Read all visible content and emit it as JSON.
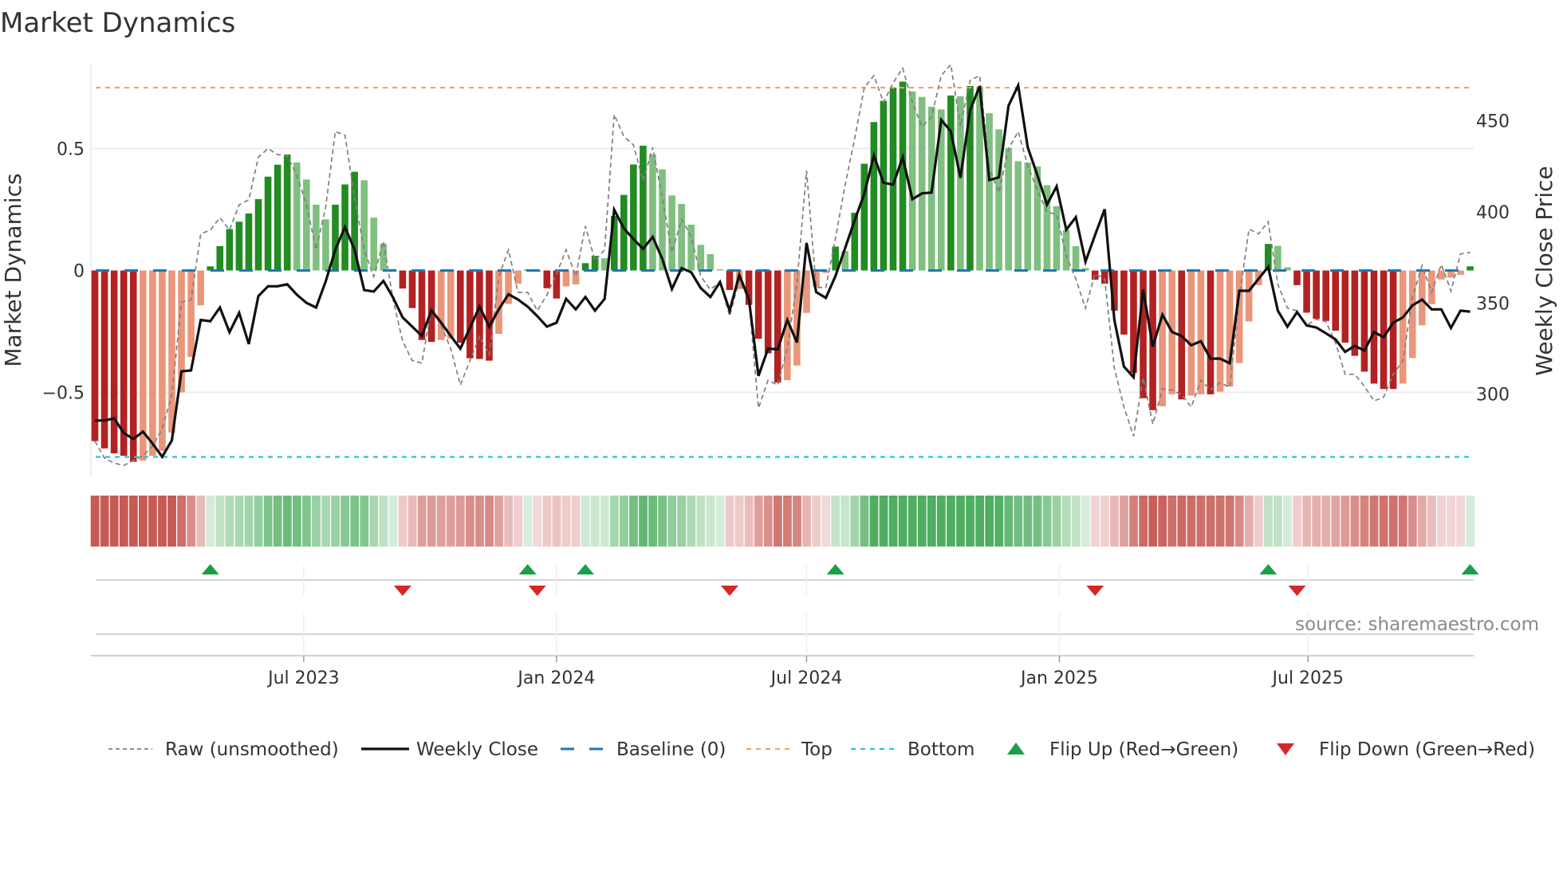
{
  "chart_data": {
    "type": "bar",
    "title": "Market Dynamics",
    "ylabel_left": "Market Dynamics",
    "ylabel_right": "Weekly Close Price",
    "source": "source: sharemaestro.com",
    "x_start": "2023-01-30",
    "x_step_days": 7,
    "ylim_left": [
      -0.845,
      0.845
    ],
    "ylim_right": [
      254.8,
      480.9
    ],
    "yticks_left": [
      {
        "v": 0.5,
        "label": "0.5"
      },
      {
        "v": 0,
        "label": "0"
      },
      {
        "v": -0.5,
        "label": "−0.5"
      }
    ],
    "yticks_right": [
      {
        "v": 450,
        "label": "450"
      },
      {
        "v": 400,
        "label": "400"
      },
      {
        "v": 350,
        "label": "350"
      },
      {
        "v": 300,
        "label": "300"
      }
    ],
    "xticks": [
      {
        "date": "2023-07-01",
        "label": "Jul 2023"
      },
      {
        "date": "2024-01-01",
        "label": "Jan 2024"
      },
      {
        "date": "2024-07-01",
        "label": "Jul 2024"
      },
      {
        "date": "2025-01-01",
        "label": "Jan 2025"
      },
      {
        "date": "2025-07-01",
        "label": "Jul 2025"
      }
    ],
    "top_level": 0.75,
    "bottom_level": -0.765,
    "baseline": 0,
    "grid": true,
    "colors": {
      "dark_red": "#b22222",
      "light_red": "#e9967a",
      "dark_green": "#228b22",
      "light_green": "#7fbf7f",
      "price": "#111111",
      "raw": "#808080",
      "baseline": "#1f77b4",
      "top": "#f4a261",
      "bottom": "#22c5d6",
      "flip_up": "#1a9e48",
      "flip_down": "#d62728",
      "strip_red": "192,72,66",
      "strip_green": "60,165,80"
    },
    "momentum": [
      -0.7,
      -0.73,
      -0.75,
      -0.76,
      -0.785,
      -0.78,
      -0.76,
      -0.74,
      -0.665,
      -0.5,
      -0.355,
      -0.143,
      0.017,
      0.1,
      0.17,
      0.2,
      0.234,
      0.293,
      0.385,
      0.434,
      0.476,
      0.443,
      0.373,
      0.27,
      0.21,
      0.27,
      0.353,
      0.405,
      0.37,
      0.217,
      0.11,
      0.006,
      -0.074,
      -0.154,
      -0.285,
      -0.293,
      -0.285,
      -0.28,
      -0.296,
      -0.36,
      -0.363,
      -0.37,
      -0.26,
      -0.137,
      -0.054,
      0.004,
      -0.005,
      -0.073,
      -0.115,
      -0.065,
      -0.057,
      0.03,
      0.06,
      0.05,
      0.224,
      0.31,
      0.435,
      0.512,
      0.476,
      0.415,
      0.308,
      0.273,
      0.188,
      0.105,
      0.067,
      0.005,
      -0.08,
      -0.076,
      -0.141,
      -0.28,
      -0.34,
      -0.46,
      -0.45,
      -0.39,
      -0.174,
      -0.067,
      -0.01,
      0.098,
      0.08,
      0.237,
      0.438,
      0.609,
      0.696,
      0.75,
      0.775,
      0.735,
      0.712,
      0.672,
      0.661,
      0.718,
      0.715,
      0.757,
      0.755,
      0.645,
      0.579,
      0.503,
      0.448,
      0.443,
      0.427,
      0.35,
      0.264,
      0.166,
      0.1,
      0.01,
      -0.038,
      -0.054,
      -0.165,
      -0.263,
      -0.42,
      -0.524,
      -0.573,
      -0.557,
      -0.508,
      -0.529,
      -0.513,
      -0.508,
      -0.508,
      -0.497,
      -0.476,
      -0.38,
      -0.209,
      -0.06,
      0.109,
      0.101,
      0.013,
      -0.06,
      -0.173,
      -0.198,
      -0.207,
      -0.247,
      -0.296,
      -0.35,
      -0.415,
      -0.464,
      -0.486,
      -0.486,
      -0.464,
      -0.359,
      -0.225,
      -0.138,
      -0.037,
      -0.029,
      -0.018,
      0.017
    ],
    "shade": "DDDDDLLLLLLLDDDDDDDDDLLLLDDDLLLLDDDDLLDDDDLLLDLDDLLDDLDDDDLLLLLLLLDLDDDDLLLLLDLDDDDDDLLLLDLDLLLLLLLLLLLLDDDDDDDLLDLLDLLLLLDLLDDDDDDDDDDDLLLLLLLD",
    "raw": [
      -0.7,
      -0.77,
      -0.79,
      -0.8,
      -0.78,
      -0.76,
      -0.72,
      -0.65,
      -0.51,
      -0.13,
      -0.12,
      0.15,
      0.166,
      0.217,
      0.166,
      0.27,
      0.29,
      0.465,
      0.5,
      0.476,
      0.47,
      0.39,
      0.27,
      0.085,
      0.26,
      0.57,
      0.555,
      0.3,
      0.085,
      -0.025,
      0.12,
      -0.12,
      -0.29,
      -0.37,
      -0.38,
      -0.155,
      -0.225,
      -0.32,
      -0.47,
      -0.37,
      -0.27,
      -0.345,
      -0.024,
      0.085,
      -0.09,
      -0.09,
      -0.165,
      -0.1,
      -0.013,
      0.085,
      -0.024,
      0.182,
      0.04,
      0.085,
      0.64,
      0.55,
      0.515,
      0.367,
      0.505,
      0.3,
      0.074,
      0.21,
      0.14,
      -0.024,
      -0.078,
      -0.046,
      -0.187,
      -0.04,
      -0.12,
      -0.565,
      -0.45,
      -0.47,
      -0.32,
      -0.05,
      0.41,
      -0.07,
      -0.07,
      0.13,
      0.35,
      0.54,
      0.75,
      0.8,
      0.69,
      0.77,
      0.83,
      0.69,
      0.59,
      0.63,
      0.8,
      0.845,
      0.59,
      0.78,
      0.8,
      0.42,
      0.32,
      0.5,
      0.57,
      0.43,
      0.33,
      0.24,
      0.23,
      0.06,
      -0.035,
      -0.155,
      -0.013,
      -0.035,
      -0.4,
      -0.56,
      -0.68,
      -0.44,
      -0.63,
      -0.486,
      -0.49,
      -0.51,
      -0.56,
      -0.45,
      -0.49,
      -0.46,
      -0.48,
      -0.11,
      0.17,
      0.15,
      0.2,
      -0.057,
      -0.154,
      -0.165,
      -0.225,
      -0.2,
      -0.21,
      -0.296,
      -0.426,
      -0.426,
      -0.475,
      -0.535,
      -0.52,
      -0.426,
      -0.37,
      -0.11,
      0.02,
      -0.09,
      0.025,
      -0.084,
      0.068,
      0.074
    ],
    "price": [
      285.5,
      285.5,
      286.7,
      278.7,
      275.3,
      279.4,
      272.8,
      265.6,
      274.6,
      312.5,
      313,
      340.7,
      340,
      347.5,
      334,
      344.6,
      327.5,
      353.8,
      359.2,
      359.2,
      360.3,
      354.5,
      350.1,
      347.5,
      361.8,
      379.3,
      391.7,
      379.3,
      357.1,
      356.3,
      362.1,
      353,
      342.1,
      337,
      331.9,
      346,
      339.2,
      331.9,
      325,
      336.3,
      348,
      337,
      346.5,
      354.8,
      351.9,
      348,
      342.8,
      337,
      339.2,
      352.3,
      346.5,
      353.3,
      345.8,
      352.3,
      401.2,
      391,
      385.1,
      379.7,
      386.3,
      374.2,
      357.7,
      369.1,
      366.9,
      358.2,
      353.3,
      361.5,
      345.8,
      365.4,
      352.3,
      310,
      325,
      324.6,
      340.7,
      328.3,
      383,
      356,
      352.8,
      364.7,
      380,
      395.3,
      409.9,
      431,
      416,
      415,
      430,
      407,
      410.2,
      410.6,
      450.5,
      444.2,
      418.7,
      455.8,
      469,
      417.5,
      419,
      458.3,
      469.4,
      435.4,
      420.1,
      404,
      414,
      390.2,
      397.1,
      372.7,
      387.3,
      401.5,
      340.7,
      315.1,
      309.3,
      357.4,
      326,
      343.6,
      334.1,
      331.9,
      326.8,
      329,
      319.5,
      319.5,
      316.9,
      356.7,
      356.7,
      363.3,
      369.8,
      345.8,
      337,
      345,
      337.7,
      336.6,
      333.4,
      330,
      323.2,
      326.5,
      323.9,
      334.1,
      331.2,
      339.2,
      342.1,
      348.7,
      351.9,
      346.5,
      346.5,
      336.3,
      345.8,
      345.3
    ],
    "flips_up": [
      12,
      45,
      51,
      77,
      122,
      143
    ],
    "flips_down": [
      32,
      46,
      66,
      104,
      125
    ],
    "legend": {
      "placement": "bottom",
      "items": [
        {
          "label": "Raw (unsmoothed)",
          "kind": "raw"
        },
        {
          "label": "Weekly Close",
          "kind": "price"
        },
        {
          "label": "Baseline (0)",
          "kind": "baseline"
        },
        {
          "label": "Top",
          "kind": "top"
        },
        {
          "label": "Bottom",
          "kind": "bottom"
        },
        {
          "label": "Flip Up (Red→Green)",
          "kind": "up"
        },
        {
          "label": "Flip Down (Green→Red)",
          "kind": "down"
        }
      ]
    }
  }
}
